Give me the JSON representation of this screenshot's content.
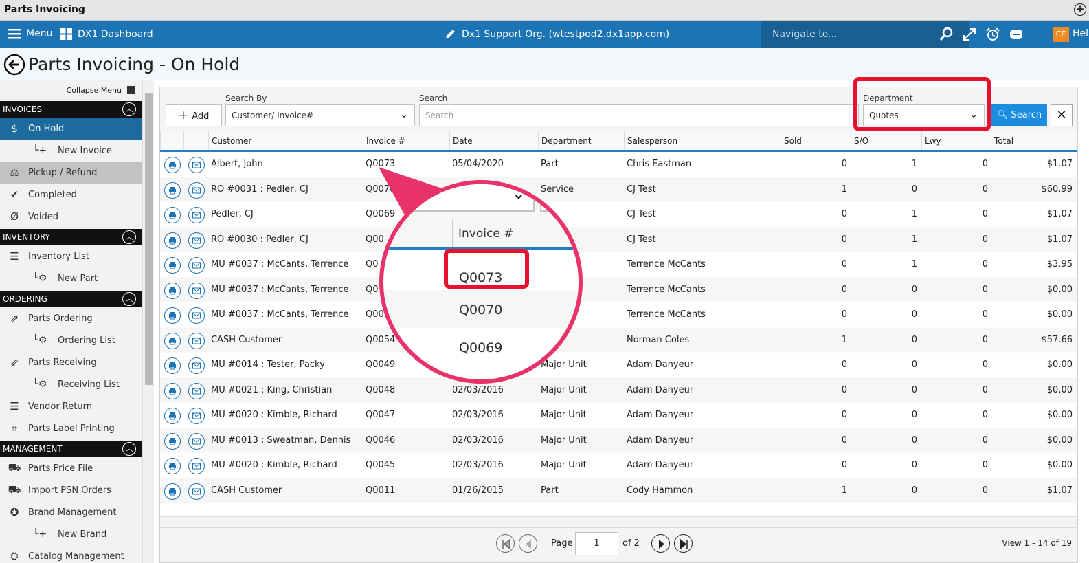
{
  "window": {
    "title": "Parts Invoicing"
  },
  "topbar": {
    "menu": "Menu",
    "dashboard": "DX1 Dashboard",
    "org": "Dx1 Support Org. (wtestpod2.dx1app.com)",
    "navigate_placeholder": "Navigate to...",
    "avatar": "CE",
    "help": "Help"
  },
  "page": {
    "title": "Parts Invoicing - On Hold"
  },
  "sidebar": {
    "collapse": "Collapse Menu",
    "invoices": {
      "header": "INVOICES",
      "items": [
        {
          "label": "On Hold",
          "icon": "dollar-icon"
        },
        {
          "label": "New Invoice",
          "icon": "plus-icon"
        },
        {
          "label": "Pickup / Refund",
          "icon": "pickup-icon"
        },
        {
          "label": "Completed",
          "icon": "check-icon"
        },
        {
          "label": "Voided",
          "icon": "void-icon"
        }
      ]
    },
    "inventory": {
      "header": "INVENTORY",
      "items": [
        {
          "label": "Inventory List"
        },
        {
          "label": "New Part"
        }
      ]
    },
    "ordering": {
      "header": "ORDERING",
      "items": [
        {
          "label": "Parts Ordering"
        },
        {
          "label": "Ordering List"
        },
        {
          "label": "Parts Receiving"
        },
        {
          "label": "Receiving List"
        },
        {
          "label": "Vendor Return"
        },
        {
          "label": "Parts Label Printing"
        }
      ]
    },
    "management": {
      "header": "MANAGEMENT",
      "items": [
        {
          "label": "Parts Price File"
        },
        {
          "label": "Import PSN Orders"
        },
        {
          "label": "Brand Management"
        },
        {
          "label": "New Brand"
        },
        {
          "label": "Catalog Management"
        }
      ]
    }
  },
  "toolbar": {
    "add": "Add",
    "search_by_label": "Search By",
    "search_by_value": "Customer/ Invoice#",
    "search_label": "Search",
    "search_placeholder": "Search",
    "department_label": "Department",
    "department_value": "Quotes",
    "search_button": "Search"
  },
  "grid": {
    "columns": [
      "Customer",
      "Invoice #",
      "Date",
      "Department",
      "Salesperson",
      "Sold",
      "S/O",
      "Lwy",
      "Total"
    ],
    "rows": [
      [
        "Albert, John",
        "Q0073",
        "05/04/2020",
        "Part",
        "Chris Eastman",
        "0",
        "1",
        "0",
        "$1.07"
      ],
      [
        "RO #0031 : Pedler, CJ",
        "Q0070",
        "",
        "Service",
        "CJ Test",
        "1",
        "0",
        "0",
        "$60.99"
      ],
      [
        "Pedler, CJ",
        "Q0069",
        "",
        "",
        "CJ Test",
        "0",
        "1",
        "0",
        "$1.07"
      ],
      [
        "RO #0030 : Pedler, CJ",
        "Q00",
        "",
        "",
        "CJ Test",
        "0",
        "1",
        "0",
        "$1.07"
      ],
      [
        "MU #0037 : McCants, Terrence",
        "Q0",
        "",
        "nit",
        "Terrence McCants",
        "0",
        "1",
        "0",
        "$3.95"
      ],
      [
        "MU #0037 : McCants, Terrence",
        "Q0",
        "",
        "nit",
        "Terrence McCants",
        "0",
        "0",
        "0",
        "$0.00"
      ],
      [
        "MU #0037 : McCants, Terrence",
        "Q005",
        "",
        "Unit",
        "Terrence McCants",
        "0",
        "0",
        "0",
        "$0.00"
      ],
      [
        "CASH Customer",
        "Q0054",
        "",
        "art",
        "Norman Coles",
        "1",
        "0",
        "0",
        "$57.66"
      ],
      [
        "MU #0014 : Tester, Packy",
        "Q0049",
        "",
        "Major Unit",
        "Adam Danyeur",
        "0",
        "0",
        "0",
        "$0.00"
      ],
      [
        "MU #0021 : King, Christian",
        "Q0048",
        "02/03/2016",
        "Major Unit",
        "Adam Danyeur",
        "0",
        "0",
        "0",
        "$0.00"
      ],
      [
        "MU #0020 : Kimble, Richard",
        "Q0047",
        "02/03/2016",
        "Major Unit",
        "Adam Danyeur",
        "0",
        "0",
        "0",
        "$0.00"
      ],
      [
        "MU #0013 : Sweatman, Dennis",
        "Q0046",
        "02/03/2016",
        "Major Unit",
        "Adam Danyeur",
        "0",
        "0",
        "0",
        "$0.00"
      ],
      [
        "MU #0020 : Kimble, Richard",
        "Q0045",
        "02/03/2016",
        "Major Unit",
        "Adam Danyeur",
        "0",
        "0",
        "0",
        "$0.00"
      ],
      [
        "CASH Customer",
        "Q0011",
        "01/26/2015",
        "Part",
        "Cody Hammon",
        "1",
        "0",
        "0",
        "$1.07"
      ]
    ]
  },
  "pager": {
    "page_label": "Page",
    "page_value": "1",
    "of": "of 2",
    "view": "View 1 - 14 of 19"
  },
  "magnifier": {
    "header": "Invoice #",
    "values": [
      "Q0073",
      "Q0070",
      "Q0069"
    ]
  },
  "colors": {
    "brand": "#1c74b4",
    "highlight": "#e8112d",
    "magnifier_border": "#e8336a"
  }
}
